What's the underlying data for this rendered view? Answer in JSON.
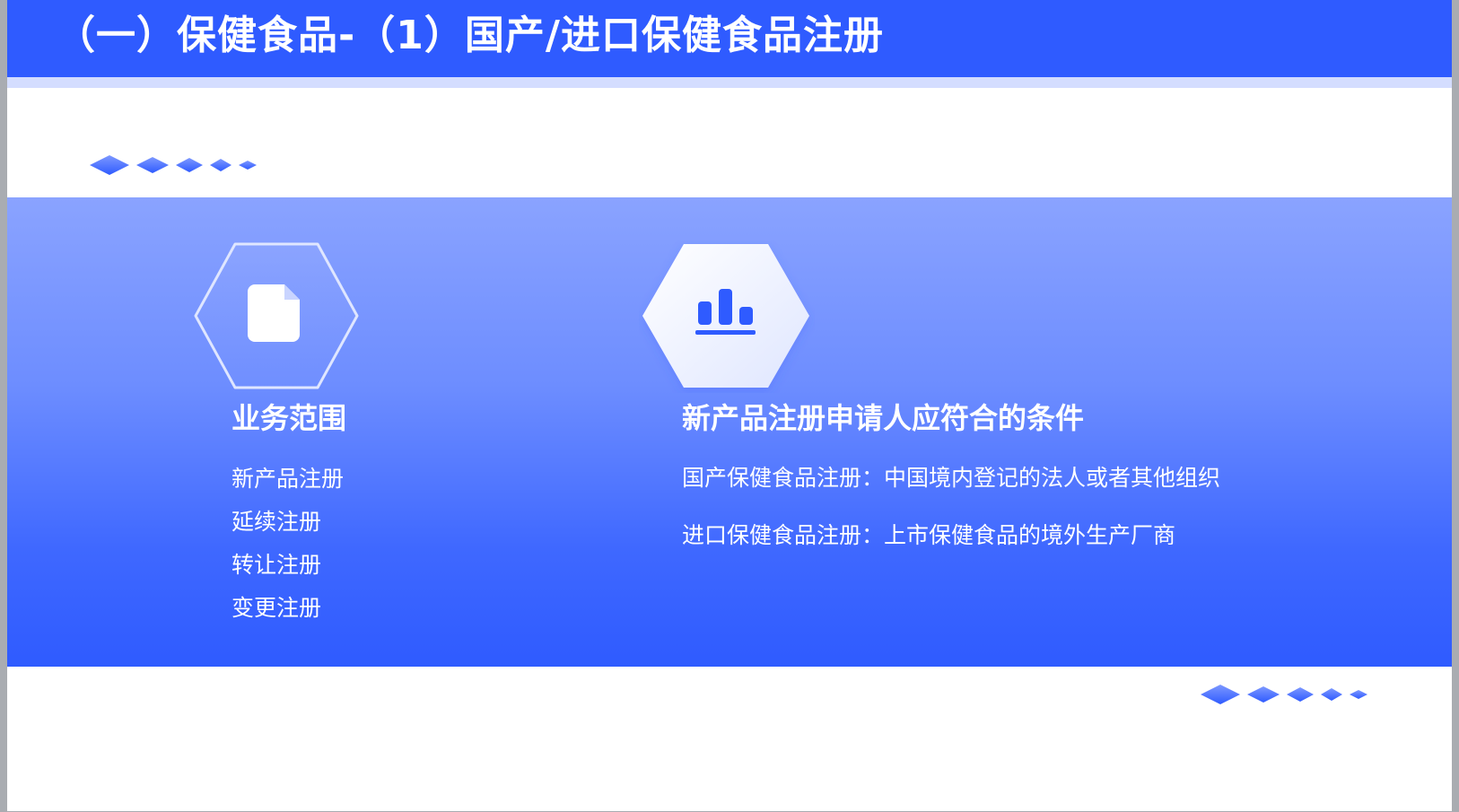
{
  "header": {
    "title": "（一）保健食品-（1）国产/进口保健食品注册"
  },
  "colors": {
    "brand_blue": "#2f5bff",
    "light_strip": "#d4ddff",
    "panel_top": "#8aa3ff",
    "white": "#ffffff"
  },
  "scope": {
    "icon": "document-icon",
    "title": "业务范围",
    "items": [
      {
        "label": "新产品注册"
      },
      {
        "label": "延续注册"
      },
      {
        "label": "转让注册"
      },
      {
        "label": "变更注册"
      }
    ]
  },
  "conditions": {
    "icon": "bar-chart-icon",
    "title": "新产品注册申请人应符合的条件",
    "lines": [
      {
        "text": "国产保健食品注册：中国境内登记的法人或者其他组织"
      },
      {
        "text": "进口保健食品注册：上市保健食品的境外生产厂商"
      }
    ]
  }
}
